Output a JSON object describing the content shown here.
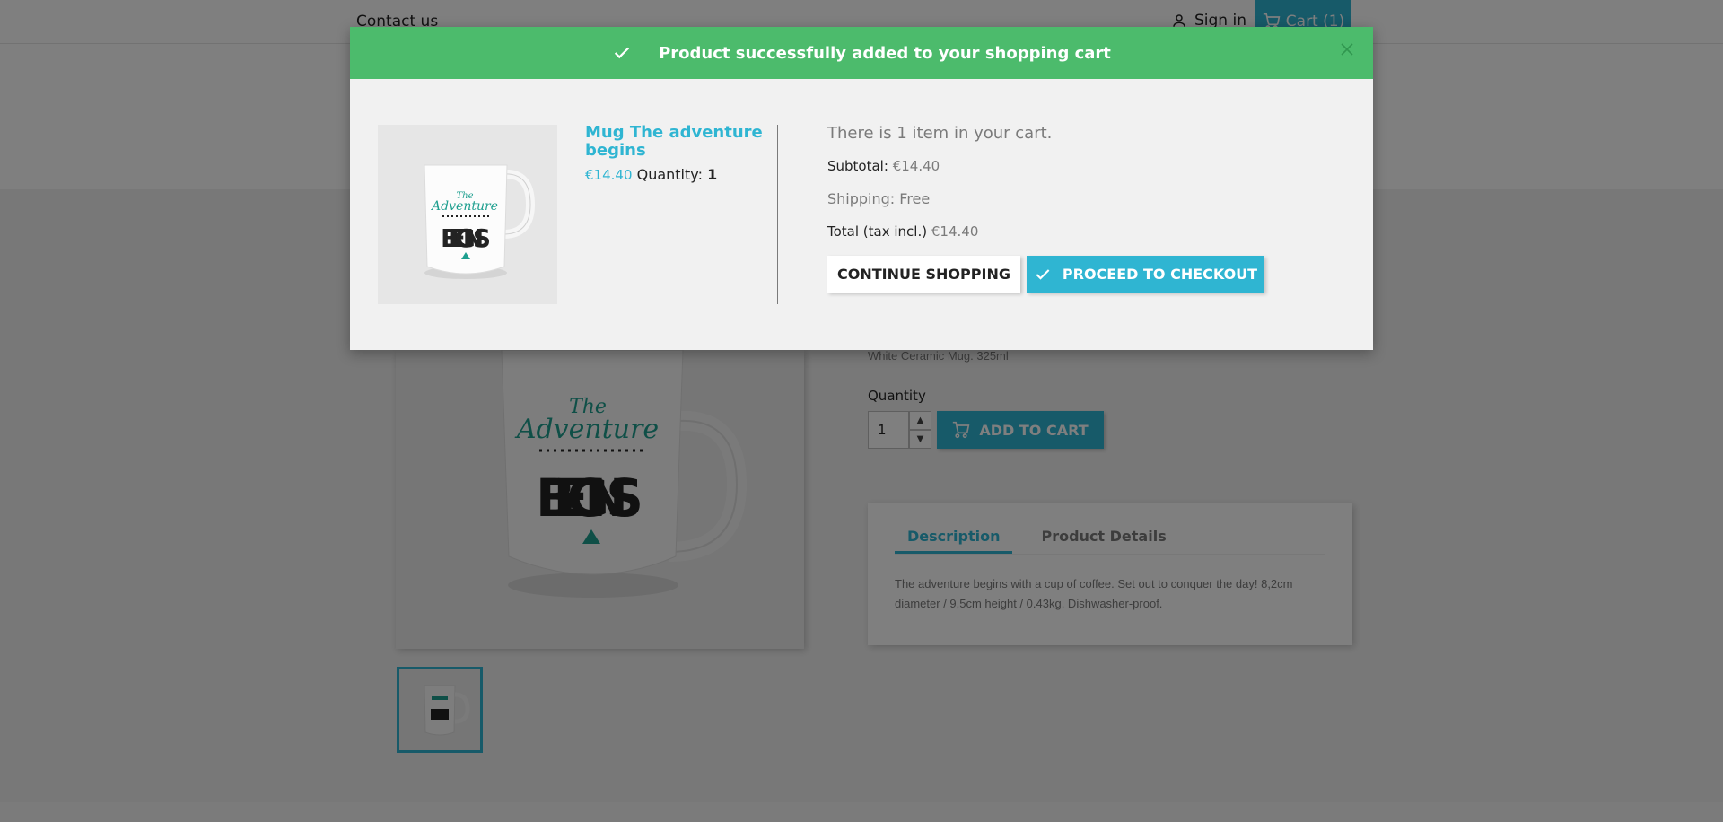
{
  "header": {
    "contact_label": "Contact us",
    "signin_label": "Sign in",
    "cart_label": "Cart (1)"
  },
  "product": {
    "short_description": "White Ceramic Mug. 325ml",
    "quantity_label": "Quantity",
    "quantity_value": "1",
    "add_to_cart_label": "ADD TO CART",
    "tabs": [
      {
        "label": "Description",
        "active": true
      },
      {
        "label": "Product Details",
        "active": false
      }
    ],
    "description": "The adventure begins with a cup of coffee. Set out to conquer the day! 8,2cm diameter / 9,5cm height / 0.43kg. Dishwasher-proof.",
    "mug_art": {
      "line1": "The",
      "line2": "Adventure",
      "line3": "BEGINS"
    }
  },
  "modal": {
    "title": "Product successfully added to your shopping cart",
    "product_name": "Mug The adventure begins",
    "product_price": "€14.40",
    "quantity_label": "Quantity:",
    "quantity_value": "1",
    "cart_count_text": "There is 1 item in your cart.",
    "subtotal_label": "Subtotal:",
    "subtotal_value": "€14.40",
    "shipping_label": "Shipping:",
    "shipping_value": "Free",
    "total_label": "Total (tax incl.)",
    "total_value": "€14.40",
    "continue_label": "CONTINUE SHOPPING",
    "checkout_label": "PROCEED TO CHECKOUT"
  },
  "colors": {
    "accent": "#2fb5d2",
    "success": "#4cbb6c",
    "mug_teal": "#1e9f8f"
  },
  "icons": [
    "person-icon",
    "cart-icon",
    "check-icon",
    "close-icon",
    "chevron-up-icon",
    "chevron-down-icon"
  ]
}
